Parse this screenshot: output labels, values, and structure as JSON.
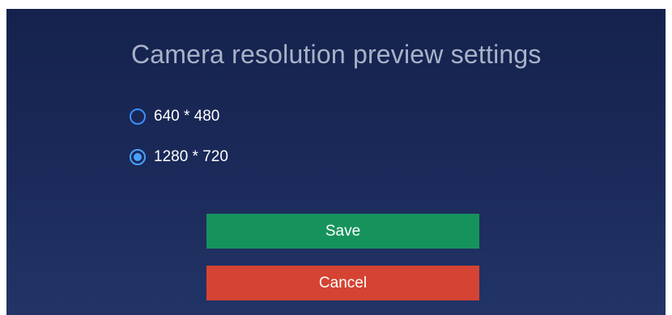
{
  "dialog": {
    "title": "Camera resolution preview settings",
    "options": [
      {
        "label": "640 * 480",
        "selected": false
      },
      {
        "label": "1280 * 720",
        "selected": true
      }
    ],
    "save_label": "Save",
    "cancel_label": "Cancel"
  },
  "colors": {
    "background_top": "#15224d",
    "background_bottom": "#223466",
    "title_text": "#a9b2c8",
    "radio_accent": "#4aa0ff",
    "save_button": "#16935c",
    "cancel_button": "#d54333"
  }
}
